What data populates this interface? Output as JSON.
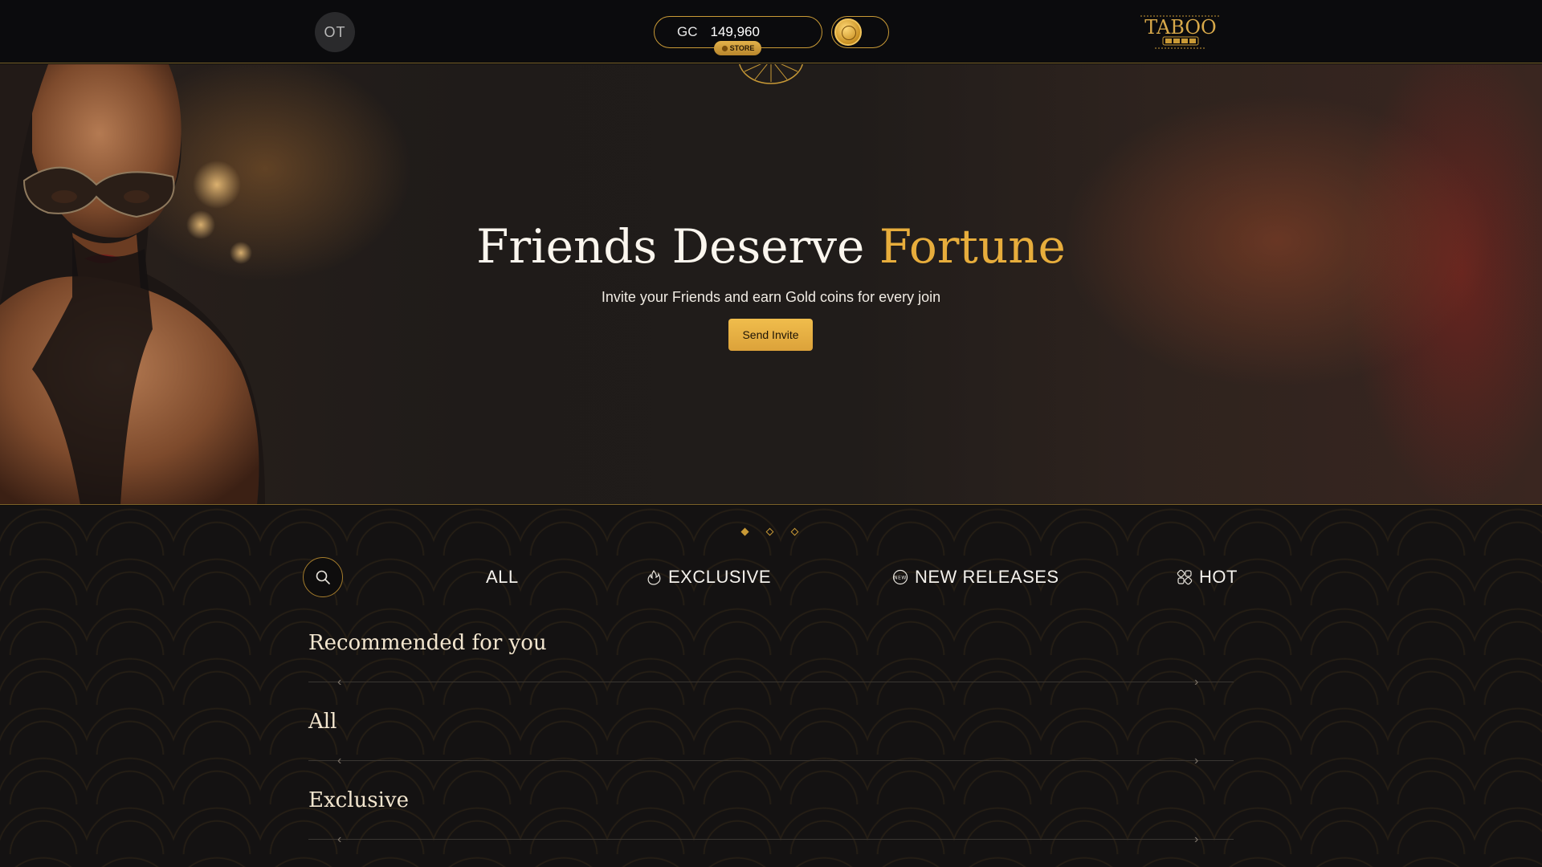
{
  "header": {
    "avatar_initials": "OT",
    "currency_code": "GC",
    "balance": "149,960",
    "store_label": "STORE",
    "logo_text": "TABOO",
    "logo_sub": "ᴄᴀꜱɪɴᴏ"
  },
  "hero": {
    "title_main": "Friends Deserve ",
    "title_accent": "Fortune",
    "subtitle": "Invite your Friends and earn Gold coins for every join",
    "button_label": "Send Invite",
    "slides_total": 3,
    "active_slide": 1
  },
  "tabs": [
    {
      "label": "ALL",
      "icon": "none"
    },
    {
      "label": "EXCLUSIVE",
      "icon": "flame-icon"
    },
    {
      "label": "NEW RELEASES",
      "icon": "new-badge-icon"
    },
    {
      "label": "HOT",
      "icon": "dice-icon"
    }
  ],
  "sections": [
    {
      "title": "Recommended for you"
    },
    {
      "title": "All"
    },
    {
      "title": "Exclusive"
    }
  ],
  "colors": {
    "gold": "#e7ad3c",
    "border_gold": "#c99a36",
    "background": "#141212"
  }
}
